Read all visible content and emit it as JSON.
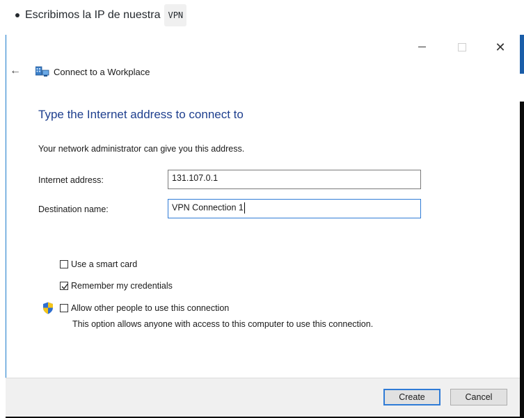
{
  "doc": {
    "bullet_text": "Escribimos la IP de nuestra",
    "code_text": "VPN"
  },
  "window": {
    "controls": {
      "minimize": "—",
      "maximize": "☐",
      "close": "✕"
    },
    "back_arrow": "←",
    "wizard_title": "Connect to a Workplace",
    "heading": "Type the Internet address to connect to",
    "subtext": "Your network administrator can give you this address.",
    "fields": {
      "internet_address_label": "Internet address:",
      "internet_address_value": "131.107.0.1",
      "destination_name_label": "Destination name:",
      "destination_name_value": "VPN Connection 1"
    },
    "options": {
      "smart_card": {
        "label": "Use a smart card",
        "checked": false
      },
      "remember_credentials": {
        "label": "Remember my credentials",
        "checked": true
      },
      "allow_others": {
        "label": "Allow other people to use this connection",
        "checked": false
      }
    },
    "allow_others_desc": "This option allows anyone with access to this computer to use this connection.",
    "buttons": {
      "create": "Create",
      "cancel": "Cancel"
    }
  },
  "colors": {
    "accent_blue": "#2f7bd6",
    "heading_blue": "#1e3f8e",
    "footer_bg": "#f0f0f0"
  },
  "icons": [
    "back-arrow-icon",
    "network-connection-icon",
    "uac-shield-icon",
    "checkmark-icon"
  ]
}
